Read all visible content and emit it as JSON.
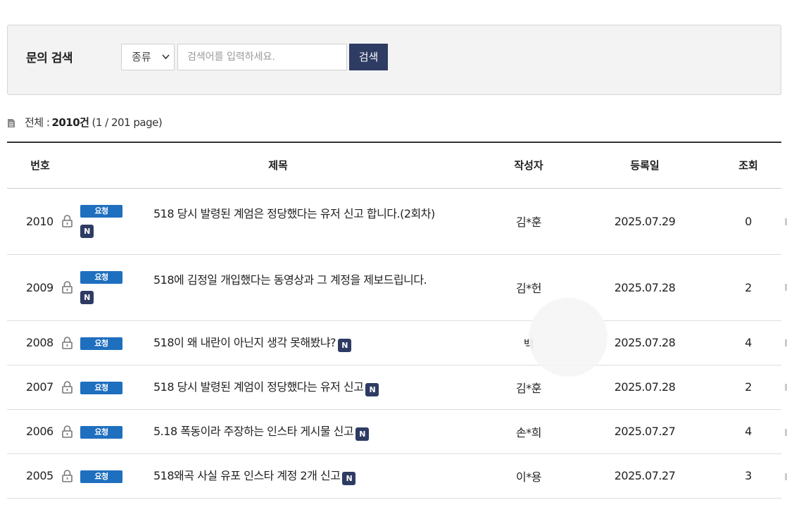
{
  "search": {
    "title": "문의 검색",
    "select_value": "종류",
    "placeholder": "검색어를 입력하세요.",
    "button_label": "검색"
  },
  "summary": {
    "label": "전체 :",
    "count": "2010건",
    "page": "(1 / 201 page)"
  },
  "table": {
    "headers": {
      "num": "번호",
      "title": "제목",
      "author": "작성자",
      "date": "등록일",
      "views": "조회"
    },
    "badge_label": "요청",
    "new_label": "N",
    "rows": [
      {
        "num": "2010",
        "title": "518 당시 발령된 계엄은 정당했다는 유저 신고 합니다.(2회차)",
        "author": "김*훈",
        "date": "2025.07.29",
        "views": "0"
      },
      {
        "num": "2009",
        "title": "518에 김정일 개입했다는 동영상과 그 계정을 제보드립니다.",
        "author": "김*헌",
        "date": "2025.07.28",
        "views": "2"
      },
      {
        "num": "2008",
        "title": "518이 왜 내란이 아닌지 생각 못해봤냐?",
        "author": "백",
        "date": "2025.07.28",
        "views": "4"
      },
      {
        "num": "2007",
        "title": "518 당시 발령된 계엄이 정당했다는 유저 신고",
        "author": "김*훈",
        "date": "2025.07.28",
        "views": "2"
      },
      {
        "num": "2006",
        "title": "5.18 폭동이라 주장하는 인스타 게시물 신고",
        "author": "손*희",
        "date": "2025.07.27",
        "views": "4"
      },
      {
        "num": "2005",
        "title": "518왜곡 사실 유포 인스타 계정 2개 신고",
        "author": "이*용",
        "date": "2025.07.27",
        "views": "3"
      }
    ]
  },
  "colors": {
    "navy": "#2e3b63",
    "badge_blue": "#1f6fbf"
  }
}
